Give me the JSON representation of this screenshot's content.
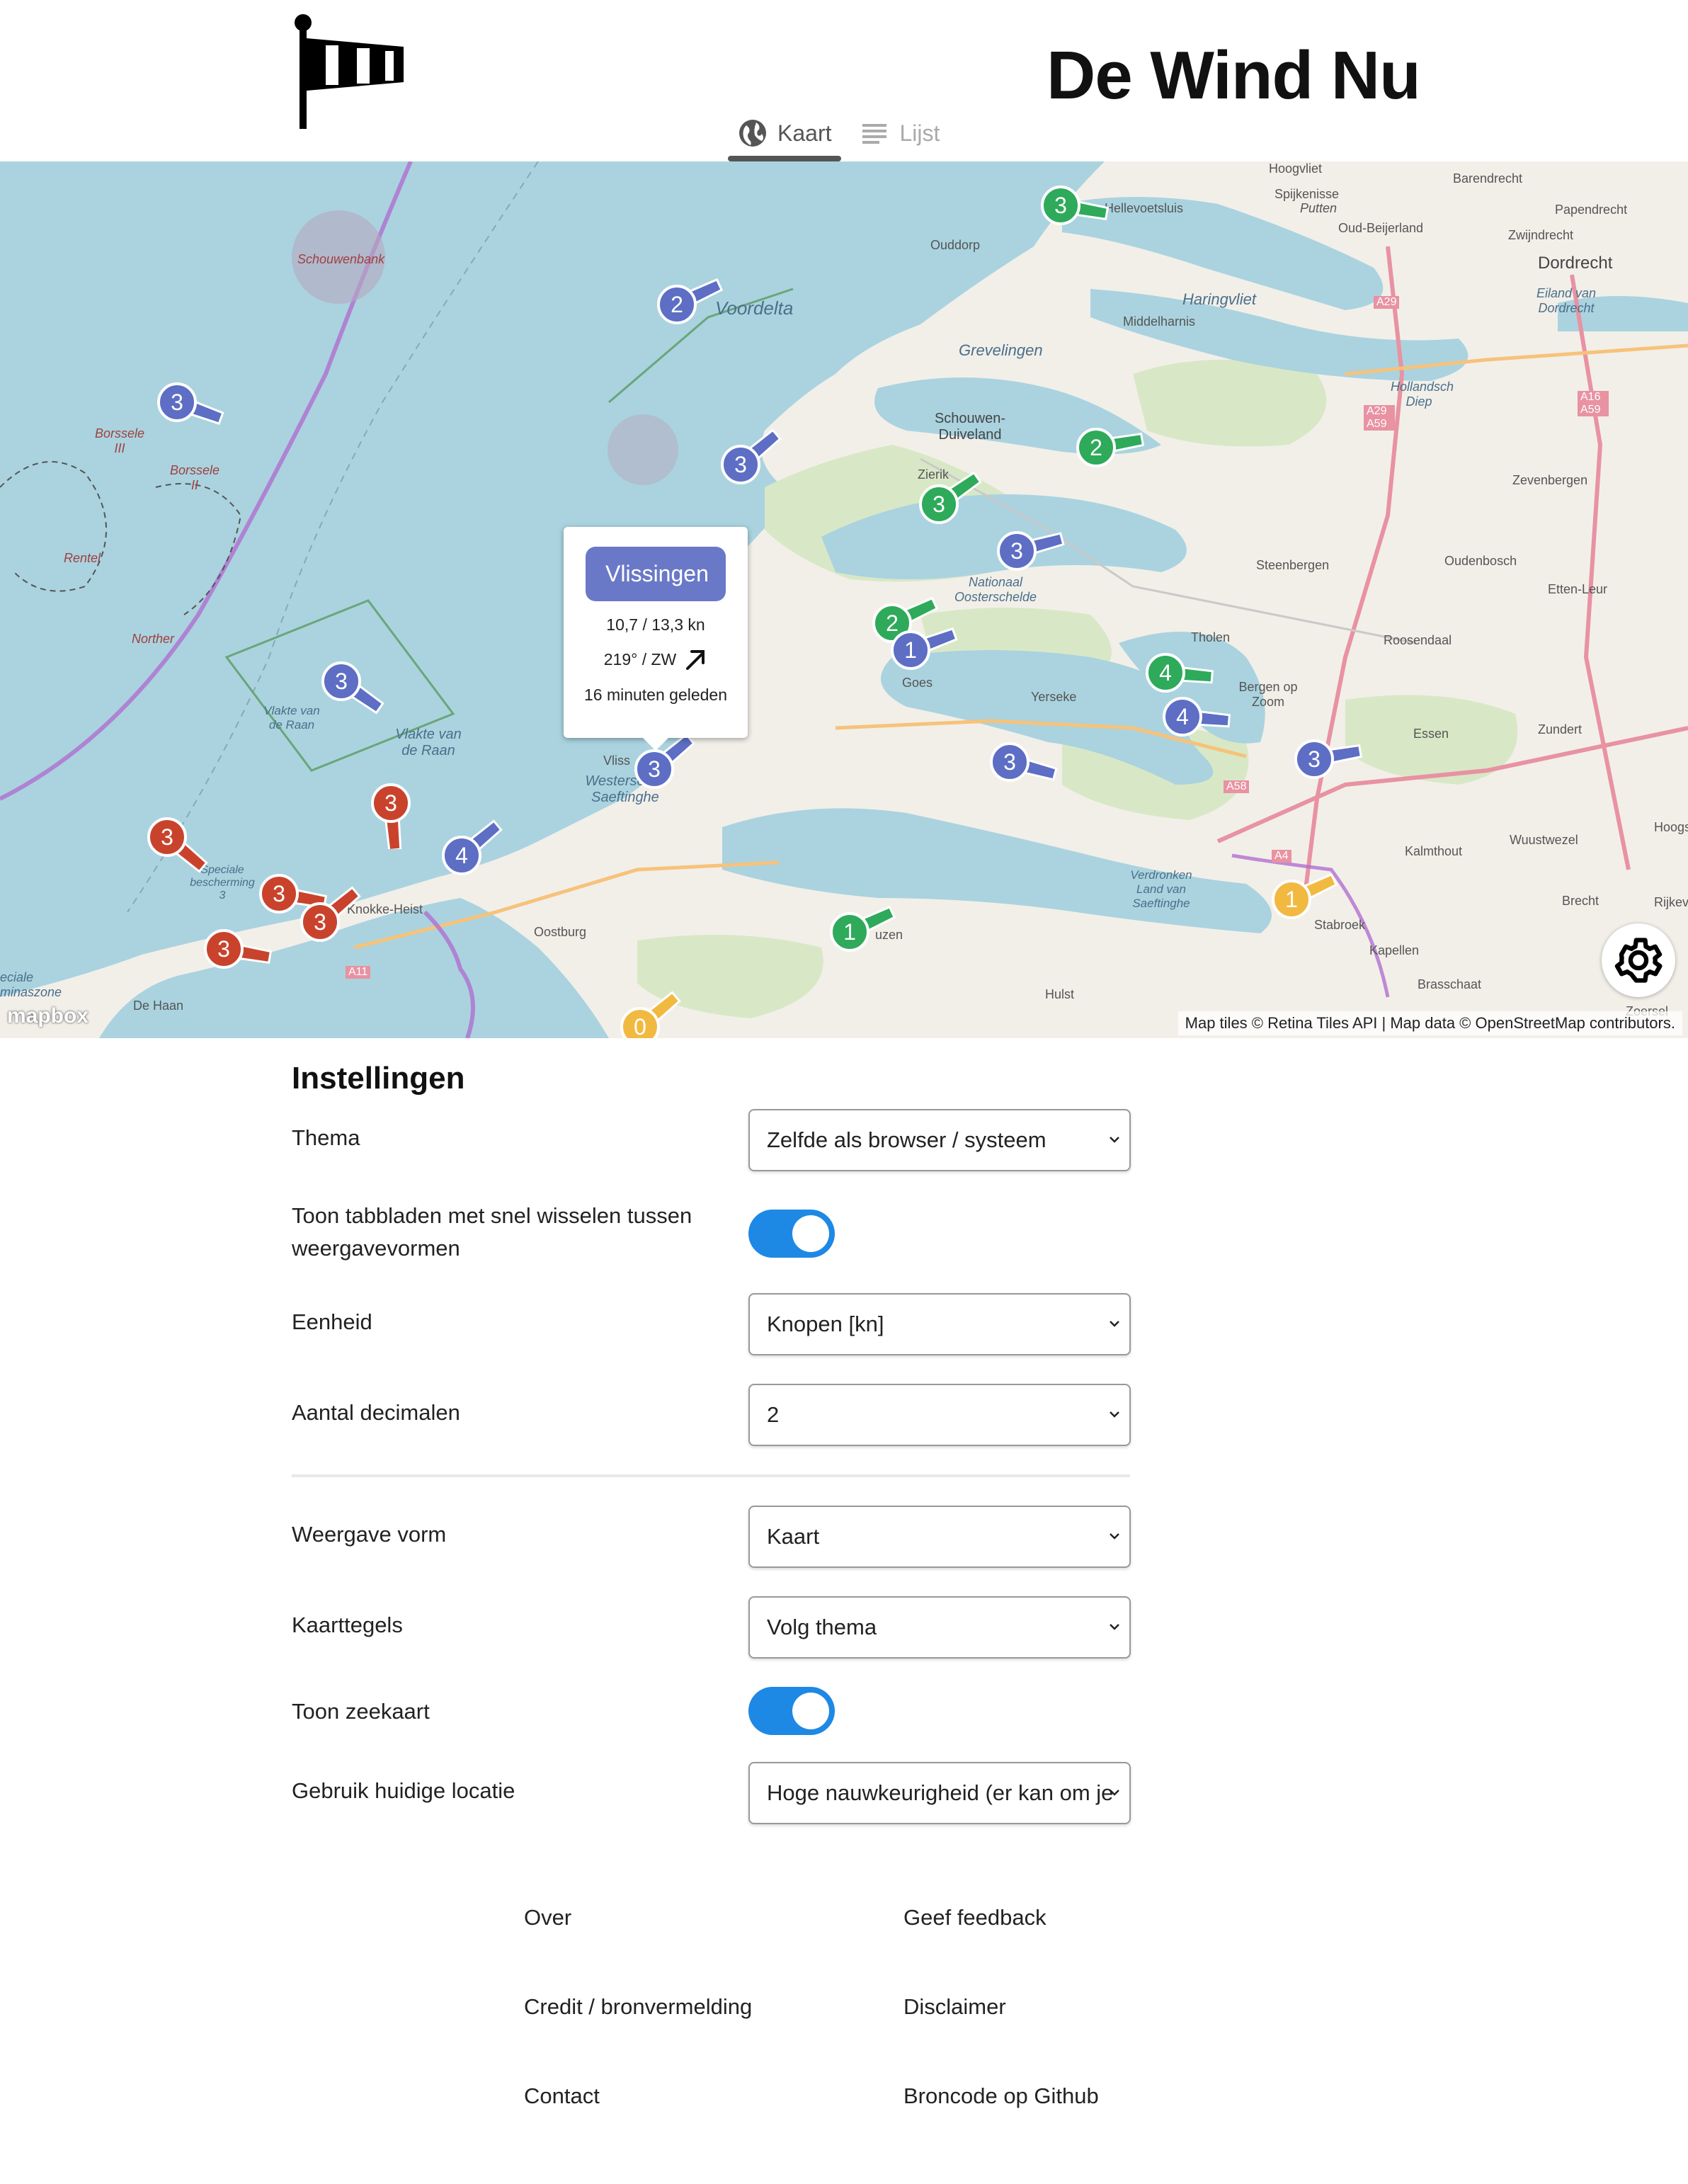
{
  "header": {
    "title": "De Wind Nu",
    "tabs": [
      {
        "label": "Kaart",
        "icon": "globe-icon",
        "active": true
      },
      {
        "label": "Lijst",
        "icon": "list-icon",
        "active": false
      }
    ]
  },
  "map": {
    "places": {
      "hellevoetsluis": "Hellevoetsluis",
      "spijkenisse": "Spijkenisse",
      "putten": "Putten",
      "hoogvliet": "Hoogvliet",
      "barendrecht": "Barendrecht",
      "oud_beijerland": "Oud-Beijerland",
      "papendrecht": "Papendrecht",
      "zwijndrecht": "Zwijndrecht",
      "dordrecht": "Dordrecht",
      "eiland_dordrecht": "Eiland van Dordrecht",
      "ouddorp": "Ouddorp",
      "schouwenbank": "Schouwenbank",
      "voordelta": "Voordelta",
      "haringvliet": "Haringvliet",
      "middelharnis": "Middelharnis",
      "grevelingen": "Grevelingen",
      "hollandsch_diep": "Hollandsch Diep",
      "schouwen_duiveland": "Schouwen-Duiveland",
      "zierikzee": "Zierik",
      "zevenbergen": "Zevenbergen",
      "borssele3": "Borssele III",
      "borssele2": "Borssele II",
      "rentel": "Rentel",
      "norther": "Norther",
      "nationaal_oosterschelde": "Nationaal Oosterschelde",
      "steenbergen": "Steenbergen",
      "oudenbosch": "Oudenbosch",
      "etten_leur": "Etten-Leur",
      "tholen": "Tholen",
      "roosendaal": "Roosendaal",
      "goes": "Goes",
      "yerseke": "Yerseke",
      "bergen_op_zoom": "Bergen op Zoom",
      "essen": "Essen",
      "zundert": "Zundert",
      "vlakte_van_de_raan_a": "Vlakte van de Raan",
      "vlakte_van_de_raan_b": "Vlakte van de Raan",
      "vlissingen": "Vliss",
      "westerschelde": "Westersch & Saeftinghe",
      "kalmthout": "Kalmthout",
      "wuustwezel": "Wuustwezel",
      "speciale_bescherming": "Speciale bescherming 3",
      "knokke": "Knokke-Heist",
      "oostburg": "Oostburg",
      "verdronken_land": "Verdronken Land van Saeftinghe",
      "stabroek": "Stabroek",
      "kapellen": "Kapellen",
      "brasschaat": "Brasschaat",
      "brecht": "Brecht",
      "hulst": "Hulst",
      "de_haan": "De Haan",
      "terneuzen": "uzen",
      "zoersel": "Zoersel",
      "hoogs": "Hoogs",
      "rijkev": "Rijkev",
      "speciale_zone": "eciale minaszone",
      "road_a29": "A29",
      "road_a29_a59": "A29 A59",
      "road_a16_a59": "A16 A59",
      "road_a58": "A58",
      "road_a4": "A4",
      "road_a11": "A11"
    },
    "markers": [
      {
        "label": "3",
        "color": "#2eaa5a",
        "dir": 10
      },
      {
        "label": "2",
        "color": "#5d6ec4",
        "dir": -25
      },
      {
        "label": "3",
        "color": "#5d6ec4",
        "dir": 20
      },
      {
        "label": "3",
        "color": "#5d6ec4",
        "dir": -40
      },
      {
        "label": "2",
        "color": "#2eaa5a",
        "dir": -10
      },
      {
        "label": "3",
        "color": "#2eaa5a",
        "dir": -35
      },
      {
        "label": "3",
        "color": "#5d6ec4",
        "dir": -15
      },
      {
        "label": "2",
        "color": "#2eaa5a",
        "dir": -25
      },
      {
        "label": "1",
        "color": "#5d6ec4",
        "dir": -20
      },
      {
        "label": "3",
        "color": "#5d6ec4",
        "dir": 35
      },
      {
        "label": "4",
        "color": "#2eaa5a",
        "dir": 5
      },
      {
        "label": "4",
        "color": "#5d6ec4",
        "dir": 5
      },
      {
        "label": "3",
        "color": "#5d6ec4",
        "dir": -10
      },
      {
        "label": "3",
        "color": "#5d6ec4",
        "dir": 15
      },
      {
        "label": "3",
        "color": "#5d6ec4",
        "dir": -40
      },
      {
        "label": "3",
        "color": "#c9432c",
        "dir": 85
      },
      {
        "label": "3",
        "color": "#c9432c",
        "dir": 40
      },
      {
        "label": "4",
        "color": "#5d6ec4",
        "dir": -40
      },
      {
        "label": "3",
        "color": "#c9432c",
        "dir": 10
      },
      {
        "label": "3",
        "color": "#c9432c",
        "dir": -40
      },
      {
        "label": "3",
        "color": "#c9432c",
        "dir": 10
      },
      {
        "label": "1",
        "color": "#2eaa5a",
        "dir": -25
      },
      {
        "label": "1",
        "color": "#f2b941",
        "dir": -25
      },
      {
        "label": "0",
        "color": "#f2b941",
        "dir": -40
      }
    ],
    "popup": {
      "station": "Vlissingen",
      "speed": "10,7 / 13,3 kn",
      "direction": "219° / ZW",
      "age": "16 minuten geleden"
    },
    "attribution": "Map tiles © Retina Tiles API | Map data © OpenStreetMap contributors.",
    "mapbox": "mapbox"
  },
  "settings": {
    "heading": "Instellingen",
    "theme": {
      "label": "Thema",
      "value": "Zelfde als browser / systeem"
    },
    "tabs_toggle": {
      "label": "Toon tabbladen met snel wisselen tussen weergavevormen",
      "on": true
    },
    "unit": {
      "label": "Eenheid",
      "value": "Knopen [kn]"
    },
    "decimals": {
      "label": "Aantal decimalen",
      "value": "2"
    },
    "view": {
      "label": "Weergave vorm",
      "value": "Kaart"
    },
    "tiles": {
      "label": "Kaarttegels",
      "value": "Volg thema"
    },
    "seachart": {
      "label": "Toon zeekaart",
      "on": true
    },
    "location": {
      "label": "Gebruik huidige locatie",
      "value": "Hoge nauwkeurigheid (er kan om je"
    }
  },
  "footer": {
    "over": "Over",
    "feedback": "Geef feedback",
    "credit": "Credit / bronvermelding",
    "disclaimer": "Disclaimer",
    "contact": "Contact",
    "github": "Broncode op Github"
  },
  "colors": {
    "accent": "#1e88e5",
    "water": "#aad3df",
    "land": "#f2efe9"
  }
}
